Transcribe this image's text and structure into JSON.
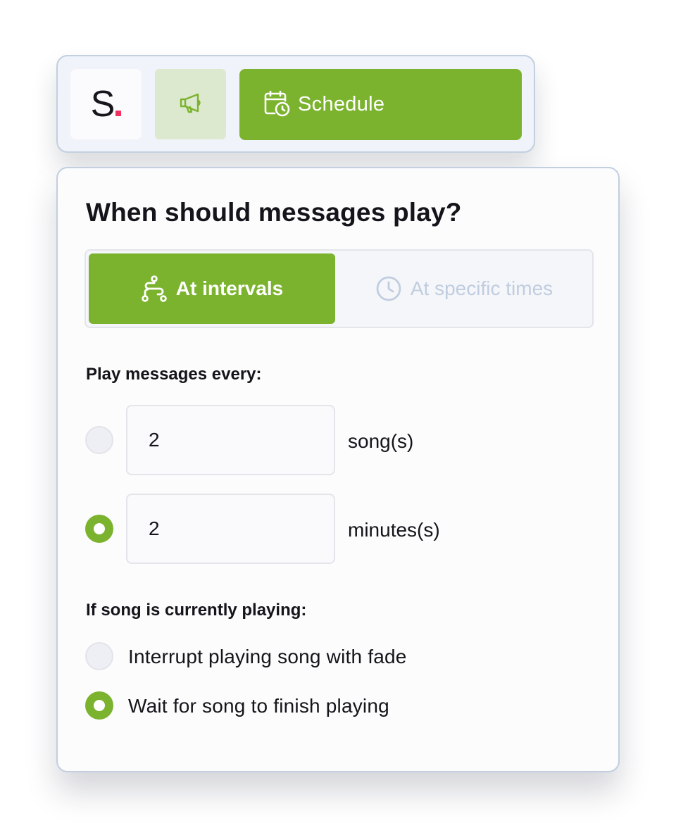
{
  "toolbar": {
    "logo_text": "S",
    "schedule_label": "Schedule",
    "icons": {
      "megaphone": "megaphone-icon",
      "calendar": "calendar-clock-icon"
    }
  },
  "panel": {
    "title": "When should messages play?",
    "mode_tabs": [
      {
        "label": "At intervals",
        "icon": "route-icon",
        "selected": true
      },
      {
        "label": "At specific times",
        "icon": "clock-icon",
        "selected": false
      }
    ],
    "interval_section": {
      "label": "Play messages every:",
      "options": [
        {
          "value": "2",
          "unit": "song(s)",
          "selected": false
        },
        {
          "value": "2",
          "unit": "minutes(s)",
          "selected": true
        }
      ]
    },
    "playing_section": {
      "label": "If song is currently playing:",
      "options": [
        {
          "label": "Interrupt playing song with fade",
          "selected": false
        },
        {
          "label": "Wait for song to finish playing",
          "selected": true
        }
      ]
    }
  },
  "colors": {
    "accent": "#7bb32e",
    "accent_light": "#dde9cf",
    "border": "#c2cfe1",
    "logo_dot": "#f0315e",
    "inactive_text": "#c0cde0"
  }
}
